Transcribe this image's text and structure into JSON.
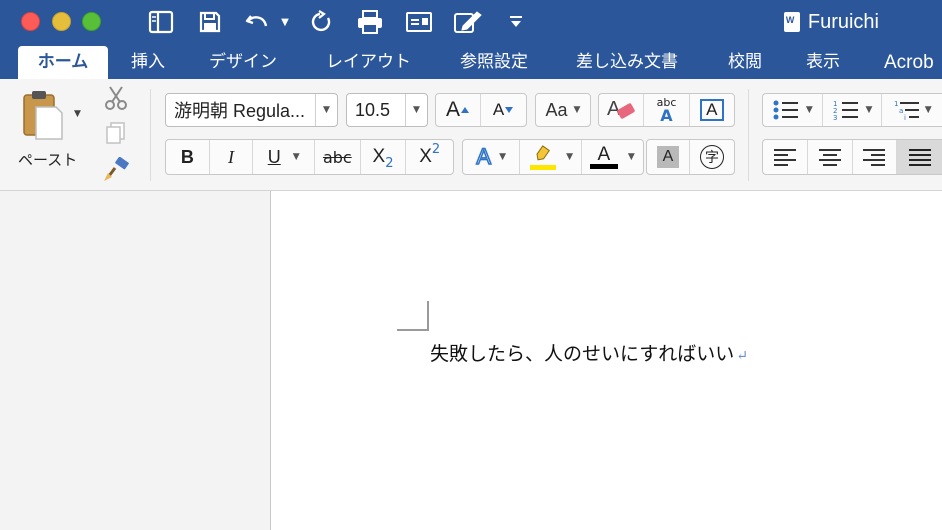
{
  "window": {
    "title": "Furuichi"
  },
  "tabs": [
    {
      "label": "ホーム",
      "active": true
    },
    {
      "label": "挿入"
    },
    {
      "label": "デザイン"
    },
    {
      "label": "レイアウト"
    },
    {
      "label": "参照設定"
    },
    {
      "label": "差し込み文書"
    },
    {
      "label": "校閲"
    },
    {
      "label": "表示"
    },
    {
      "label": "Acrob"
    }
  ],
  "clipboard": {
    "paste_label": "ペースト"
  },
  "font": {
    "name": "游明朝 Regula...",
    "size": "10.5"
  },
  "formatting": {
    "bold": "B",
    "italic": "I",
    "underline": "U",
    "strikethrough": "abc",
    "subscript_base": "X",
    "subscript_mark": "2",
    "superscript_base": "X",
    "superscript_mark": "2",
    "grow_font": "A",
    "shrink_font": "A",
    "change_case": "Aa",
    "phonetic_top": "abc",
    "phonetic_bottom": "A",
    "char_border": "A",
    "text_effects": "A",
    "font_color": "A",
    "char_shading": "A",
    "enclose_char": "字"
  },
  "colors": {
    "titlebar": "#2b579a",
    "highlight": "#ffe600",
    "font_color": "#000000",
    "accent": "#2b579a"
  },
  "document": {
    "text": "失敗したら、人のせいにすればいい",
    "paragraph_mark": "↵"
  }
}
